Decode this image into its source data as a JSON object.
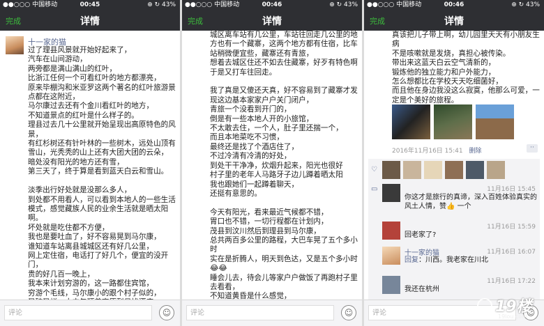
{
  "panels": [
    {
      "status": {
        "carrier": "●●○○○ 中国移动 ",
        "time": "00:45",
        "battery": "⊕ ↻ 43%"
      },
      "nav": {
        "done": "完成",
        "title": "详情"
      },
      "author": "十一家的猫",
      "text": "过了理县风景就开始好起来了，\n汽车在山间游动，\n两旁都是满山满山的红叶，\n比浙江任何一个可看红叶的地方都漂亮，\n原来毕棚沟和米亚罗这两个著名的红叶旅游景点都在这附近，\n马尔康过去还有个金川看红叶的地方，\n不知道景点的红叶是什么样子的。\n理县过去几十公里就开始呈现出高原特色的风景，\n有红杉树还有针叶林的一些树木，远处山顶有雪山，光秃秃的山上还有大团大团的云朵，\n暗处没有阳光的地方还有雪，\n第三天了，终于算是看到蓝天白云和雪山。\n\n淡季出行好处就是没那么多人，\n到处都不用看人，可以看到本地人的一些生活模式，感觉藏族人民的业余生活就是晒太阳啊。\n坏处就是吃住都不方便，\n我也是要吐血了，好不容易晃到马尔康，\n谁知道车站离县城城区还有好几公里，\n网上定住宿，电话打了好几个，便宜的没开门，\n贵的好几百一晚上，\n我本来计划穷游的，这一路都住宾馆，\n穷游个毛线，马尔康小的跟个村子似的，\n又破又烂，大中午顶着高原烈日找酒店。",
      "input_placeholder": "评论"
    },
    {
      "status": {
        "carrier": "●●○○○ 中国移动 ",
        "time": "00:46",
        "battery": "⊕ ↻ 43%"
      },
      "nav": {
        "done": "完成",
        "title": "详情"
      },
      "text": "城区离车站有几公里，车站往回走几公里的地方也有一个藏寨，这两个地方都有住宿，比车站稍微便宜些，藏寨还有青旅，\n想着去城区住还不如去住藏寨，好歹有特色啊\n于是又打车往回走。\n\n我了真是又傻还天真，好不容易到了藏寨才发现这边基本家家户户关门闭户，\n青旅一个没看到开门的，\n倒是有一些本地人开的小旅馆，\n不太敢去住，一个人，肚子里还揣一个，\n而且本地菜吃不习惯，\n最终还是找了个酒店住了，\n不过冷清有冷清的好处，\n到处干干净净，炊烟升起来，阳光也很好\n村子里的老年人马路牙子边儿蹲着晒太阳\n我也跟她们一起蹲着聊天，\n还挺有意思的。\n\n今天有阳光，看来最近气候都不错，\n胃口也不错，一切行程都在计划内，\n茂县到汶川然后到理县到马尔康，\n总共两百多公里的路程，大巴车晃了五个多小时\n实在是折腾人，明天到色达，又是五个多小时😂😂\n睡会儿去，待会儿等家户户做饭了再跑村子里去看看，\n不知道黄昏是什么感觉，\n要知道一路上身体完全没反应，",
      "input_placeholder": "评论"
    },
    {
      "status": {
        "carrier": "●●○○○ 中国移动 ",
        "time": "00:46",
        "battery": "⊕ ↻ 43%"
      },
      "nav": {
        "done": "完成",
        "title": "详情"
      },
      "text": "真该把儿子带上啊，幼儿园里天天有小朋友生病\n不是咳嗽就是发烧，真担心被传染。\n带出来这蓝天白云空气清新的，\n锻炼他的独立能力和户外能力，\n怎么想都比在学校天天吃细菌好，\n而且他在身边我没这么寂寞，他那么可爱，一定是个美好的旅程。",
      "timestamp": "2016年11月16日 15:41",
      "delete": "删除",
      "more": "··",
      "comments": [
        {
          "name": "",
          "time": "11月16日 15:45",
          "text": "你这才是旅行的真谛，深入百姓体验真实的风土人情，赞👍  一个"
        },
        {
          "name": "",
          "time": "11月16日 15:59",
          "text": "回老家了?"
        },
        {
          "name": "十一家的猫",
          "time": "11月16日 16:07",
          "reply_label": "回复",
          "reply_to": "",
          "text": "：川西。我老家在川北"
        },
        {
          "name": "",
          "time": "11月16日 17:22",
          "text": "我还在杭州"
        }
      ],
      "input_placeholder": "评论"
    }
  ],
  "watermark": {
    "text": "19楼",
    "sub": "19lou.com"
  },
  "colors": {
    "nav_bg": "#2e2f33",
    "accent_green": "#3dbd3d",
    "link_blue": "#5b6a92",
    "comment_bg": "#f3f3f5"
  }
}
